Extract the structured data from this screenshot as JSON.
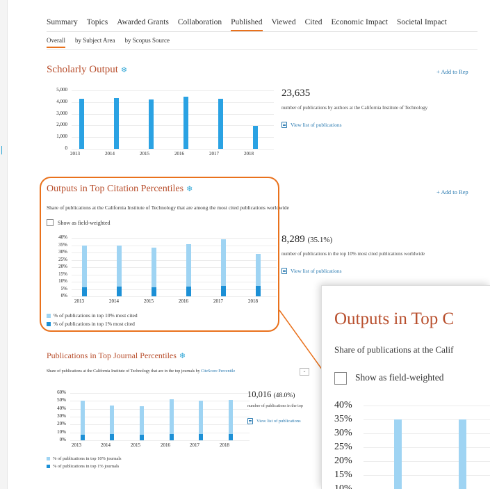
{
  "tabs": [
    "Summary",
    "Topics",
    "Awarded Grants",
    "Collaboration",
    "Published",
    "Viewed",
    "Cited",
    "Economic Impact",
    "Societal Impact"
  ],
  "active_tab": "Published",
  "subtabs": [
    "Overall",
    "by Subject Area",
    "by Scopus Source"
  ],
  "active_subtab": "Overall",
  "add_to_report": "+ Add to Rep",
  "scholarly": {
    "title": "Scholarly Output",
    "total": "23,635",
    "description": "number of publications by authors at the California Institute of Technology",
    "view_link": "View list of publications"
  },
  "citation": {
    "title": "Outputs in Top Citation Percentiles",
    "description": "Share of publications at the California Institute of Technology that are among the most cited publications worldwide",
    "checkbox_label": "Show as field-weighted",
    "total": "8,289",
    "total_pct": "(35.1%)",
    "sub": "number of publications in the top 10% most cited publications worldwide",
    "view_link": "View list of publications",
    "legend": [
      "% of publications in top 10% most cited",
      "% of publications in top 1% most cited"
    ]
  },
  "journal": {
    "title": "Publications in Top Journal Percentiles",
    "description": "Share of publications at the California Institute of Technology that are in the top journals by",
    "selector": "CiteScore Percentile",
    "total": "10,016",
    "total_pct": "(48.0%)",
    "sub": "number of publications in the top",
    "view_link": "View list of publications",
    "legend": [
      "% of publications in top 10% journals",
      "% of publications in top 1% journals"
    ]
  },
  "zoom": {
    "title": "Outputs in Top C",
    "description": "Share of publications at the Calif",
    "checkbox_label": "Show as field-weighted",
    "y_ticks": [
      "40%",
      "35%",
      "30%",
      "25%",
      "20%",
      "15%",
      "10%"
    ]
  },
  "colors": {
    "light_bar": "#9fd4f3",
    "dark_bar": "#1c90d6",
    "accent": "#e9711c",
    "title": "#b84e2c"
  },
  "chart_data": [
    {
      "type": "bar",
      "title": "Scholarly Output",
      "categories": [
        "2013",
        "2014",
        "2015",
        "2016",
        "2017",
        "2018"
      ],
      "series": [
        {
          "values": [
            4300,
            4350,
            4250,
            4450,
            4300,
            1950
          ]
        }
      ],
      "y_ticks": [
        "5,000",
        "4,000",
        "3,000",
        "2,000",
        "1,000",
        "0"
      ],
      "ylim": [
        0,
        5000
      ]
    },
    {
      "type": "bar",
      "title": "Outputs in Top Citation Percentiles",
      "categories": [
        "2013",
        "2014",
        "2015",
        "2016",
        "2017",
        "2018"
      ],
      "series": [
        {
          "name": "% of publications in top 10% most cited",
          "values": [
            35,
            35,
            33.5,
            35.5,
            39,
            29
          ]
        },
        {
          "name": "% of publications in top 1% most cited",
          "values": [
            6,
            6.5,
            6,
            6.5,
            7,
            7
          ]
        }
      ],
      "y_ticks": [
        "40%",
        "35%",
        "30%",
        "25%",
        "20%",
        "15%",
        "10%",
        "5%",
        "0%"
      ],
      "ylim": [
        0,
        40
      ]
    },
    {
      "type": "bar",
      "title": "Publications in Top Journal Percentiles",
      "categories": [
        "2013",
        "2014",
        "2015",
        "2016",
        "2017",
        "2018"
      ],
      "series": [
        {
          "name": "% of publications in top 10% journals",
          "values": [
            50,
            44,
            43,
            52,
            50,
            51
          ]
        },
        {
          "name": "% of publications in top 1% journals",
          "values": [
            7,
            8,
            7,
            8,
            8,
            8
          ]
        }
      ],
      "y_ticks": [
        "60%",
        "50%",
        "40%",
        "30%",
        "20%",
        "10%",
        "0%"
      ],
      "ylim": [
        0,
        60
      ]
    }
  ]
}
